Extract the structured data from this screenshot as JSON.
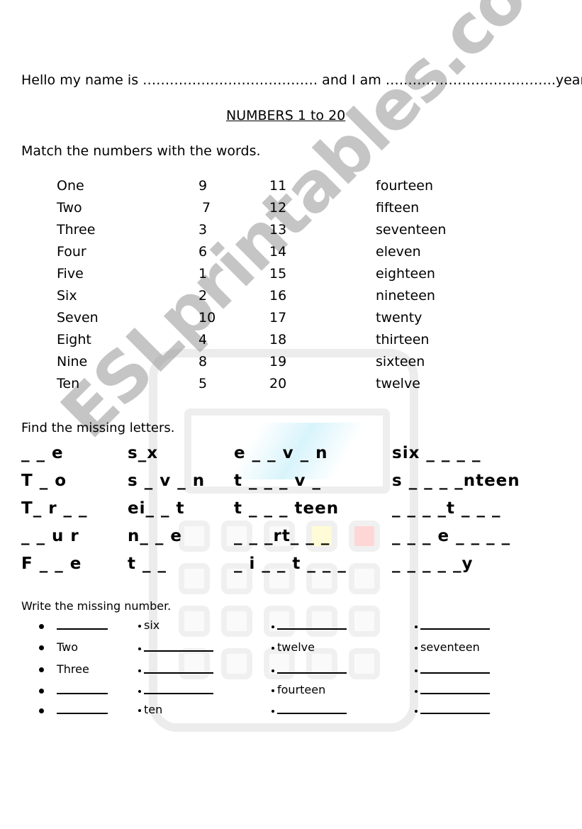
{
  "intro": {
    "text": "Hello my name is ………………………………… and I am ………………………………..years old."
  },
  "title": "NUMBERS 1 to 20",
  "match": {
    "instruction": "Match the numbers with the words.",
    "rows": [
      {
        "word": "One",
        "num": "9",
        "num2": "11",
        "word2": "fourteen"
      },
      {
        "word": "Two",
        "num": "7",
        "num2": "12",
        "word2": "fifteen"
      },
      {
        "word": "Three",
        "num": "3",
        "num2": "13",
        "word2": "seventeen"
      },
      {
        "word": "Four",
        "num": "6",
        "num2": "14",
        "word2": "eleven"
      },
      {
        "word": "Five",
        "num": "1",
        "num2": "15",
        "word2": "eighteen"
      },
      {
        "word": "Six",
        "num": "2",
        "num2": "16",
        "word2": "nineteen"
      },
      {
        "word": "Seven",
        "num": "10",
        "num2": "17",
        "word2": "twenty"
      },
      {
        "word": "Eight",
        "num": "4",
        "num2": "18",
        "word2": "thirteen"
      },
      {
        "word": "Nine",
        "num": "8",
        "num2": "19",
        "word2": "sixteen"
      },
      {
        "word": "Ten",
        "num": "5",
        "num2": "20",
        "word2": "twelve"
      }
    ]
  },
  "missing_letters": {
    "instruction": "Find the missing letters.",
    "rows": [
      [
        "_ _ e",
        "s_x",
        "e _ _ v _ n",
        "six _ _ _ _"
      ],
      [
        "T _ o",
        "s _ v _ n",
        "t _ _ _ v _",
        "s _ _ _ _nteen"
      ],
      [
        "T_ r _ _",
        "ei_ _ t",
        "t _ _ _ teen",
        "_ _ _ _t _ _ _"
      ],
      [
        "_ _ u r",
        "n_ _ e",
        "_ _ _rt_ _ _",
        "_ _ _ e _ _ _ _"
      ],
      [
        "F _ _ e",
        "t _ _",
        "_ i _ _ t _ _ _",
        "_ _ _ _ _y"
      ]
    ]
  },
  "missing_number": {
    "instruction": "Write the missing number.",
    "columns": [
      [
        "",
        "Two",
        "Three",
        "",
        ""
      ],
      [
        "six",
        "",
        "",
        "",
        "ten"
      ],
      [
        "",
        "twelve",
        "",
        "fourteen",
        ""
      ],
      [
        "",
        "seventeen",
        "",
        "",
        ""
      ]
    ]
  },
  "watermark": "ESLprintables.com"
}
